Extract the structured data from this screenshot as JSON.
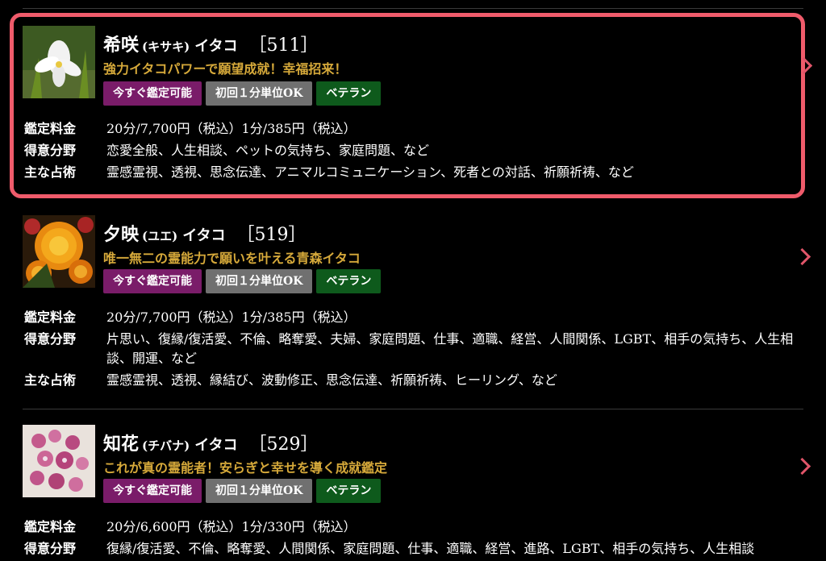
{
  "listings": [
    {
      "name": "希咲",
      "kana": "(キサキ)",
      "role": "イタコ",
      "code": "［511］",
      "tagline": "強力イタコパワーで願望成就！幸福招来！",
      "badges": [
        "今すぐ鑑定可能",
        "初回１分単位OK",
        "ベテラン"
      ],
      "fee_label": "鑑定料金",
      "fee_value": "20分/7,700円（税込）1分/385円（税込）",
      "specialty_label": "得意分野",
      "specialty_value": "恋愛全般、人生相談、ペットの気持ち、家庭問題、など",
      "method_label": "主な占術",
      "method_value": "霊感霊視、透視、思念伝達、アニマルコミュニケーション、死者との対話、祈願祈祷、など"
    },
    {
      "name": "夕映",
      "kana": "(ユエ)",
      "role": "イタコ",
      "code": "［519］",
      "tagline": "唯一無二の霊能力で願いを叶える青森イタコ",
      "badges": [
        "今すぐ鑑定可能",
        "初回１分単位OK",
        "ベテラン"
      ],
      "fee_label": "鑑定料金",
      "fee_value": "20分/7,700円（税込）1分/385円（税込）",
      "specialty_label": "得意分野",
      "specialty_value": "片思い、復縁/復活愛、不倫、略奪愛、夫婦、家庭問題、仕事、適職、経営、人間関係、LGBT、相手の気持ち、人生相談、開運、など",
      "method_label": "主な占術",
      "method_value": "霊感霊視、透視、縁結び、波動修正、思念伝達、祈願祈祷、ヒーリング、など"
    },
    {
      "name": "知花",
      "kana": "(チバナ)",
      "role": "イタコ",
      "code": "［529］",
      "tagline": "これが真の霊能者！安らぎと幸せを導く成就鑑定",
      "badges": [
        "今すぐ鑑定可能",
        "初回１分単位OK",
        "ベテラン"
      ],
      "fee_label": "鑑定料金",
      "fee_value": "20分/6,600円（税込）1分/330円（税込）",
      "specialty_label": "得意分野",
      "specialty_value": "復縁/復活愛、不倫、略奪愛、人間関係、家庭問題、仕事、適職、経営、進路、LGBT、相手の気持ち、人生相談"
    }
  ],
  "colors": {
    "highlight": "#ef5b6b",
    "tagline": "#d6a93a",
    "badge_available": "#7a1c69",
    "badge_first": "#707070",
    "badge_veteran": "#0e5a1c"
  },
  "icons": [
    "chevron-right-icon"
  ]
}
